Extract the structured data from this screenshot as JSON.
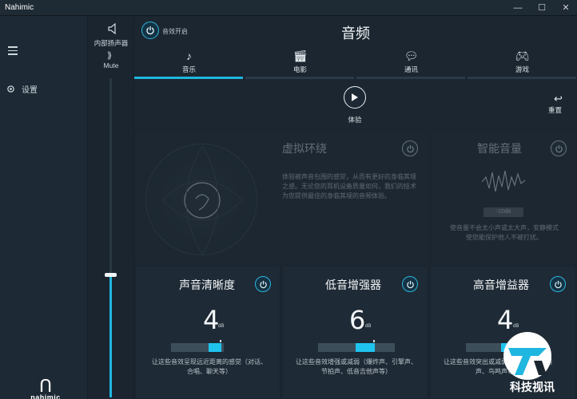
{
  "window": {
    "app_title": "Nahimic",
    "minimize": "—",
    "maximize": "☐",
    "close": "✕"
  },
  "sidebar": {
    "settings_label": "设置",
    "logo_text": "nahimic",
    "logo_mark": "ᑎ"
  },
  "volume": {
    "device_label": "内部扬声器",
    "mute_label": "Mute",
    "level": 0.38
  },
  "header": {
    "effects_label": "音效开启",
    "title": "音频"
  },
  "tabs": [
    {
      "label": "音乐",
      "icon": "music-note-icon",
      "active": true
    },
    {
      "label": "电影",
      "icon": "clapperboard-icon",
      "active": false
    },
    {
      "label": "通讯",
      "icon": "chat-icon",
      "active": false
    },
    {
      "label": "游戏",
      "icon": "gamepad-icon",
      "active": false
    }
  ],
  "controls": {
    "try_label": "体验",
    "reset_label": "重置"
  },
  "panels": {
    "virtual_surround": {
      "title": "虚拟环绕",
      "desc": "体验被声音包围的感觉，从而有更好的身临其境之感。无论您的耳机设备质量如何，我们的技术为您提供最佳的身临其境的音频体验。"
    },
    "smart_volume": {
      "title": "智能音量",
      "desc": "使音量不会太小声或太大声，安静模式使您能保护他人不被打扰。",
      "db_value": "-10dB"
    },
    "voice_clarity": {
      "title": "声音清晰度",
      "value": "4",
      "unit": "dB",
      "level": 0.72,
      "desc": "让这些音效呈现远近距离的感觉（对话、合唱、聊天等）"
    },
    "bass_boost": {
      "title": "低音增强器",
      "value": "6",
      "unit": "dB",
      "level": 0.72,
      "desc": "让这些音效增强或减弱（爆炸声、引擎声、节拍声、低音吉他声等）"
    },
    "treble_boost": {
      "title": "高音增益器",
      "value": "4",
      "unit": "dB",
      "level": 0.6,
      "desc": "让这些音效突出或减弱（脚步声、口哨声、鸟鸣声等）"
    }
  },
  "watermark": {
    "text": "科技视讯"
  }
}
